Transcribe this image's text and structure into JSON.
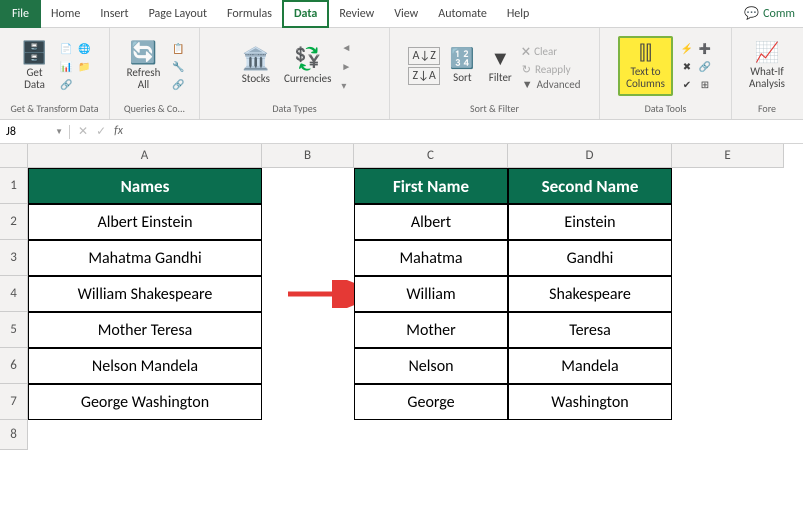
{
  "menu": {
    "file": "File",
    "tabs": [
      "Home",
      "Insert",
      "Page Layout",
      "Formulas",
      "Data",
      "Review",
      "View",
      "Automate",
      "Help"
    ],
    "active": "Data",
    "comments": "Comm"
  },
  "ribbon": {
    "getdata": {
      "btn": "Get\nData",
      "label": "Get & Transform Data"
    },
    "queries": {
      "btn": "Refresh\nAll",
      "label": "Queries & Co..."
    },
    "datatypes": {
      "stocks": "Stocks",
      "currencies": "Currencies",
      "label": "Data Types"
    },
    "sortfilter": {
      "sort": "Sort",
      "filter": "Filter",
      "clear": "Clear",
      "reapply": "Reapply",
      "advanced": "Advanced",
      "label": "Sort & Filter"
    },
    "datatools": {
      "t2c": "Text to\nColumns",
      "label": "Data Tools"
    },
    "forecast": {
      "whatif": "What-If\nAnalysis",
      "label": "Fore"
    }
  },
  "namebox": "J8",
  "cols": [
    "A",
    "B",
    "C",
    "D",
    "E"
  ],
  "rows": [
    "1",
    "2",
    "3",
    "4",
    "5",
    "6",
    "7",
    "8"
  ],
  "headers": {
    "names": "Names",
    "first": "First Name",
    "second": "Second Name"
  },
  "data": {
    "full": [
      "Albert Einstein",
      "Mahatma Gandhi",
      "William Shakespeare",
      "Mother Teresa",
      "Nelson Mandela",
      "George Washington"
    ],
    "first": [
      "Albert",
      "Mahatma",
      "William",
      "Mother",
      "Nelson",
      "George"
    ],
    "second": [
      "Einstein",
      "Gandhi",
      "Shakespeare",
      "Teresa",
      "Mandela",
      "Washington"
    ]
  }
}
